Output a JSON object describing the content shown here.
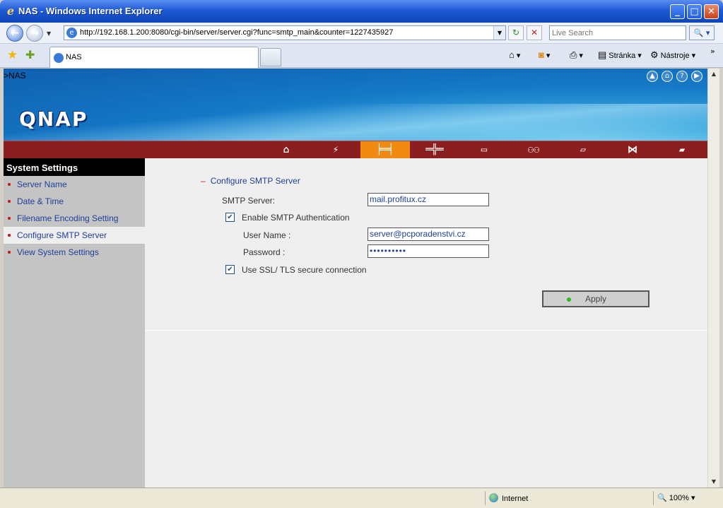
{
  "window": {
    "title": "NAS - Windows Internet Explorer"
  },
  "address": {
    "url": "http://192.168.1.200:8080/cgi-bin/server/server.cgi?func=smtp_main&counter=1227435927"
  },
  "search": {
    "placeholder": "Live Search"
  },
  "tab": {
    "label": "NAS"
  },
  "toolbar": {
    "page_label": "Stránka",
    "tools_label": "Nástroje"
  },
  "banner": {
    "breadcrumb": ">NAS",
    "logo": "QNAP"
  },
  "sidebar": {
    "heading": "System Settings",
    "items": [
      {
        "label": "Server Name"
      },
      {
        "label": "Date & Time"
      },
      {
        "label": "Filename Encoding Setting"
      },
      {
        "label": "Configure SMTP Server"
      },
      {
        "label": "View System Settings"
      }
    ]
  },
  "form": {
    "section_title": "Configure SMTP Server",
    "smtp_server_label": "SMTP Server:",
    "smtp_server_value": "mail.profitux.cz",
    "auth_label": "Enable SMTP Authentication",
    "auth_checked": true,
    "username_label": "User Name :",
    "username_value": "server@pcporadenstvi.cz",
    "password_label": "Password :",
    "password_value": "••••••••••",
    "ssl_label": "Use SSL/ TLS secure connection",
    "ssl_checked": true,
    "apply_label": "Apply"
  },
  "statusbar": {
    "zone": "Internet",
    "zoom": "100%"
  },
  "colors": {
    "nav_bar": "#8b1e1e",
    "nav_active": "#f08a12",
    "sidebar_link": "#1f3f9a"
  }
}
